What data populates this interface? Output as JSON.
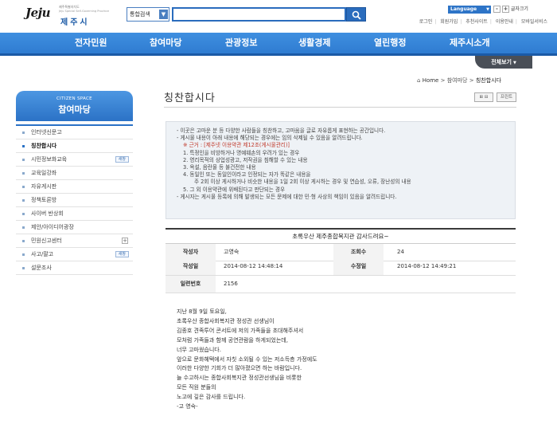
{
  "header": {
    "logo_mark": "Jeju",
    "logo_sub1": "제주특별자치도",
    "logo_sub2": "Jeju Special Self-Governing Province",
    "logo_city": "제주시",
    "search_scope": "통합검색",
    "search_value": "",
    "language_label": "Language",
    "font_size_label": "글자크기",
    "util_links": [
      "로그인",
      "회원가입",
      "추천사이트",
      "이용안내",
      "모바일서비스"
    ]
  },
  "nav": {
    "items": [
      "전자민원",
      "참여마당",
      "관광정보",
      "생활경제",
      "열린행정",
      "제주시소개"
    ],
    "all_view": "전체보기"
  },
  "sidebar": {
    "head_en": "CITIZEN SPACE",
    "head_ko": "참여마당",
    "items": [
      {
        "label": "인터넷신문고",
        "active": false,
        "tag": "",
        "plus": false
      },
      {
        "label": "칭찬합시다",
        "active": true,
        "tag": "",
        "plus": false
      },
      {
        "label": "시민정보화교육",
        "active": false,
        "tag": "새창",
        "plus": false
      },
      {
        "label": "교육일강좌",
        "active": false,
        "tag": "",
        "plus": false
      },
      {
        "label": "자유게시판",
        "active": false,
        "tag": "",
        "plus": false
      },
      {
        "label": "정책토론방",
        "active": false,
        "tag": "",
        "plus": false
      },
      {
        "label": "사이버 반상회",
        "active": false,
        "tag": "",
        "plus": false
      },
      {
        "label": "제안/아이디어광장",
        "active": false,
        "tag": "",
        "plus": false
      },
      {
        "label": "민원신고센터",
        "active": false,
        "tag": "",
        "plus": true
      },
      {
        "label": "사고/팔고",
        "active": false,
        "tag": "새창",
        "plus": false
      },
      {
        "label": "설문조사",
        "active": false,
        "tag": "",
        "plus": false
      }
    ]
  },
  "breadcrumb": {
    "home": "Home",
    "items": [
      "참여마당",
      "칭찬합시다"
    ],
    "separator": ">"
  },
  "page": {
    "title": "칭찬합시다",
    "tool_print": "⊞ ⊟",
    "tool_print2": "프린트"
  },
  "notice": {
    "lines": [
      {
        "text": "- 이곳은 고마운 분 등 다양한 사람들을 칭찬하고, 고마움을 글로 자유롭게 표현하는 공간입니다.",
        "style": ""
      },
      {
        "text": "- 게시물 내용이 아래 내용에 해당되는 경우에는 임의 삭제될 수 있음을 알려드립니다.",
        "style": ""
      },
      {
        "text": "※ 근거 : [제주넷 이용약관 제12조(게시물관리)]",
        "style": "ind1 red"
      },
      {
        "text": "1. 특정인을 비방하거나 명예훼손의 우려가 있는 경우",
        "style": "ind1"
      },
      {
        "text": "2. 영리목적의 상업성광고, 저작권을 침해할 수 있는 내용",
        "style": "ind1"
      },
      {
        "text": "3. 욕설, 음란물 등 불건전한 내용",
        "style": "ind1"
      },
      {
        "text": "4. 동일인 또는 동일인이라고 인정되는 자가 똑같은 내용을",
        "style": "ind1"
      },
      {
        "text": "주 2회 이상 게시하거나 비슷한 내용을 1일 2회 이상 게시하는 경우 및 연습성, 오류, 장난성의 내용",
        "style": "ind2"
      },
      {
        "text": "5. 그 외 이용약관에 위배된다고 판단되는 경우",
        "style": "ind1"
      },
      {
        "text": "- 게시자는 게시물 등록에 의해 발생되는 모든 문제에 대한 민·형 사상의 책임이 있음을 알려드립니다.",
        "style": ""
      }
    ]
  },
  "post": {
    "title": "초록우산 제주종합복지관 감사드려요~",
    "author_label": "작성자",
    "author": "고영숙",
    "views_label": "조회수",
    "views": "24",
    "created_label": "작성일",
    "created": "2014-08-12 14:48:14",
    "modified_label": "수정일",
    "modified": "2014-08-12 14:49:21",
    "number_label": "일련번호",
    "number": "2156",
    "body_lines": [
      "지난 8월 9일 토요일,",
      "초록우산 종합사회복지관 정성관 선생님이",
      "김종호 견족투어 콘서트에 저의 가족들을 초대해주셔서",
      "모처럼 가족들과 함께 공연관람을 하게되었는데,",
      "너무 고마웠습니다.",
      "앞으로 문화혜택에서 자칫 소외될 수 있는 저소득층 가정에도",
      "이러한 다양한 기회가 더 많아졌으면 하는 바람입니다.",
      "늘 수고하시는 종합사회복지관 정성관선생님을 비롯한",
      "모든 직원 분들의",
      "노고에 깊은 감사를 드립니다.",
      "-고 영숙-"
    ]
  },
  "colors": {
    "nav_blue": "#2f7cd1",
    "accent_red": "#c0392b"
  }
}
